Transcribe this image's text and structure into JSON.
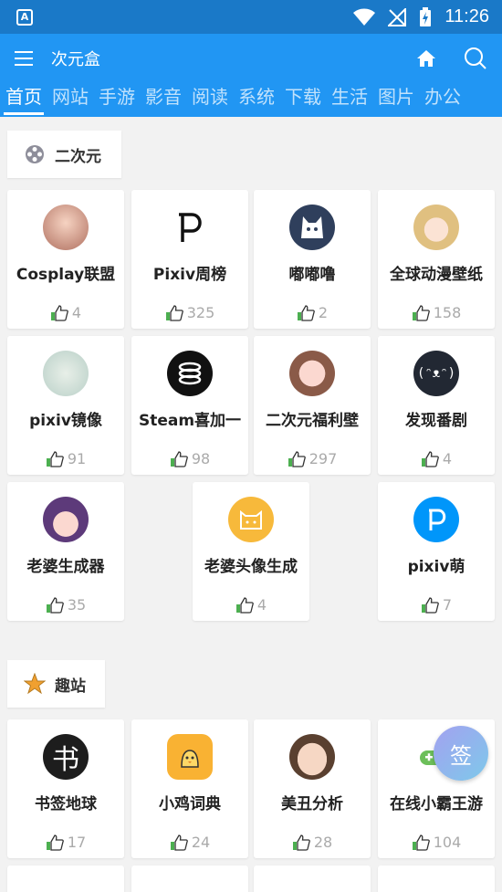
{
  "app": {
    "title": "次元盒"
  },
  "status_bar": {
    "time": "11:26",
    "app_badge": "A"
  },
  "tabs": [
    "首页",
    "网站",
    "手游",
    "影音",
    "阅读",
    "系统",
    "下载",
    "生活",
    "图片",
    "办公"
  ],
  "sections": [
    {
      "title": "二次元",
      "icon": "film-reel-icon",
      "items": [
        {
          "name": "Cosplay联盟",
          "likes": "4",
          "icon": "cosplay-avatar-icon"
        },
        {
          "name": "Pixiv周榜",
          "likes": "325",
          "icon": "pixiv-p-logo-icon"
        },
        {
          "name": "嘟嘟噜",
          "likes": "2",
          "icon": "cat-mascot-icon"
        },
        {
          "name": "全球动漫壁纸",
          "likes": "158",
          "icon": "anime-girl-icon"
        },
        {
          "name": "pixiv镜像",
          "likes": "91",
          "icon": "pixiv-mirror-icon"
        },
        {
          "name": "Steam喜加一",
          "likes": "98",
          "icon": "steam-stack-icon"
        },
        {
          "name": "二次元福利壁",
          "likes": "297",
          "icon": "anime-girl-icon"
        },
        {
          "name": "发现番剧",
          "likes": "4",
          "icon": "kaomoji-face-icon"
        },
        {
          "name": "老婆生成器",
          "likes": "35",
          "icon": "anime-girl-icon"
        },
        {
          "name": "老婆头像生成",
          "likes": "4",
          "icon": "cat-face-icon"
        },
        {
          "name": "pixiv萌",
          "likes": "7",
          "icon": "pixiv-p-logo-icon"
        }
      ]
    },
    {
      "title": "趣站",
      "icon": "star-icon",
      "items": [
        {
          "name": "书签地球",
          "likes": "17",
          "icon": "book-char-icon"
        },
        {
          "name": "小鸡词典",
          "likes": "24",
          "icon": "chick-icon"
        },
        {
          "name": "美丑分析",
          "likes": "28",
          "icon": "face-analysis-icon"
        },
        {
          "name": "在线小霸王游",
          "likes": "104",
          "icon": "gamepad-icon"
        }
      ]
    }
  ],
  "fab": {
    "label": "签"
  },
  "colors": {
    "primary": "#2196f3",
    "status_bar": "#1a79c8",
    "like_green": "#4caf50"
  }
}
